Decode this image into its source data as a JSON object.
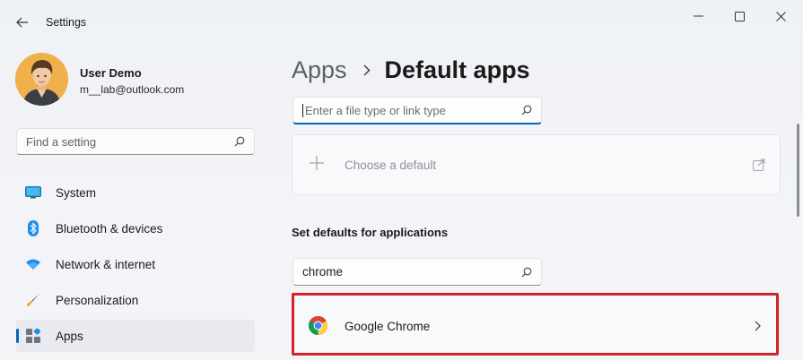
{
  "window": {
    "title": "Settings",
    "controls": [
      "minimize",
      "maximize",
      "close"
    ]
  },
  "user": {
    "name": "User Demo",
    "email": "m__lab@outlook.com"
  },
  "sidebar": {
    "search_placeholder": "Find a setting",
    "items": [
      {
        "label": "System",
        "icon": "monitor-icon",
        "active": false
      },
      {
        "label": "Bluetooth & devices",
        "icon": "bluetooth-icon",
        "active": false
      },
      {
        "label": "Network & internet",
        "icon": "wifi-icon",
        "active": false
      },
      {
        "label": "Personalization",
        "icon": "brush-icon",
        "active": false
      },
      {
        "label": "Apps",
        "icon": "apps-icon",
        "active": true
      }
    ]
  },
  "breadcrumb": {
    "parent": "Apps",
    "current": "Default apps"
  },
  "main": {
    "filetype_search_placeholder": "Enter a file type or link type",
    "choose_default_label": "Choose a default",
    "section_heading": "Set defaults for applications",
    "app_search_value": "chrome",
    "results": [
      {
        "label": "Google Chrome",
        "icon": "chrome-icon"
      }
    ]
  },
  "colors": {
    "accent": "#0067c0",
    "highlight_border": "#d42127"
  }
}
